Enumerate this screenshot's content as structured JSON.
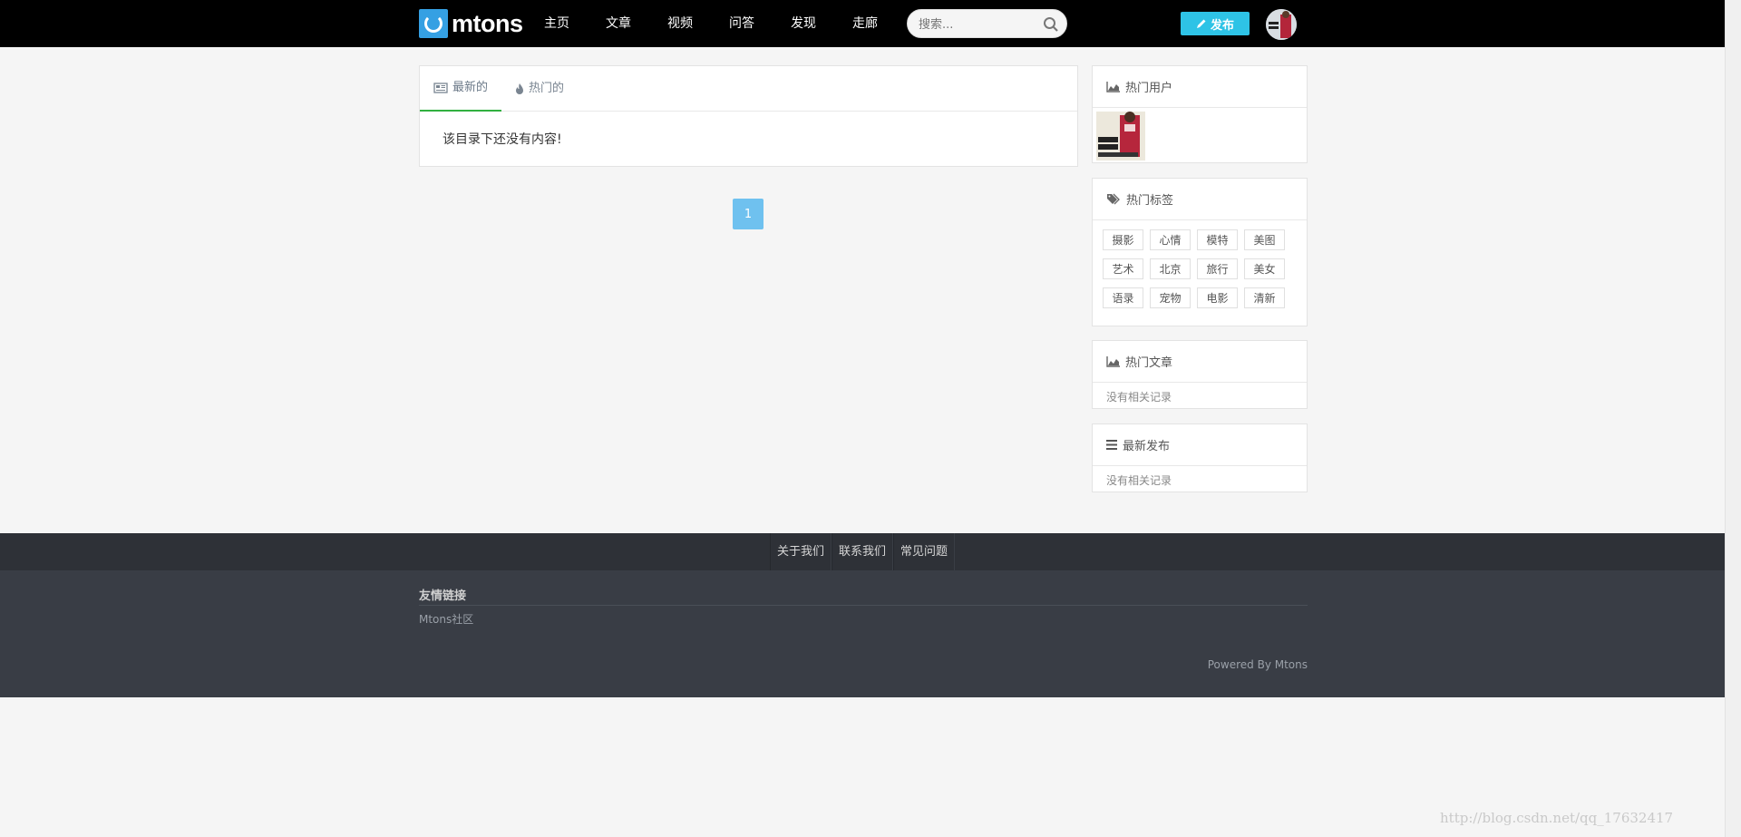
{
  "header": {
    "logo_text": "mtons",
    "nav": [
      "主页",
      "文章",
      "视频",
      "问答",
      "发现",
      "走廊"
    ],
    "search_placeholder": "搜索...",
    "publish_label": "发布"
  },
  "main": {
    "tabs": [
      {
        "label": "最新的",
        "icon": "newspaper-icon",
        "active": true
      },
      {
        "label": "热门的",
        "icon": "fire-icon",
        "active": false
      }
    ],
    "empty_text": "该目录下还没有内容!",
    "pagination": {
      "current": "1"
    }
  },
  "sidebar": {
    "hot_users": {
      "title": "热门用户",
      "icon": "area-chart-icon"
    },
    "hot_tags": {
      "title": "热门标签",
      "icon": "tags-icon",
      "tags": [
        "摄影",
        "心情",
        "模特",
        "美图",
        "艺术",
        "北京",
        "旅行",
        "美女",
        "语录",
        "宠物",
        "电影",
        "清新"
      ]
    },
    "hot_articles": {
      "title": "热门文章",
      "icon": "area-chart-icon",
      "empty": "没有相关记录"
    },
    "latest": {
      "title": "最新发布",
      "icon": "list-icon",
      "empty": "没有相关记录"
    }
  },
  "footer": {
    "links": [
      "关于我们",
      "联系我们",
      "常见问题"
    ],
    "friend_links_title": "友情链接",
    "friend_links": [
      "Mtons社区"
    ],
    "powered": "Powered By Mtons"
  },
  "watermark": "http://blog.csdn.net/qq_17632417",
  "colors": {
    "topbar": "#000000",
    "accent_publish": "#2ec3e6",
    "active_tab": "#31b040",
    "pager": "#6fc1ef",
    "footer_top": "#2e3137",
    "footer_body": "#393d45"
  }
}
